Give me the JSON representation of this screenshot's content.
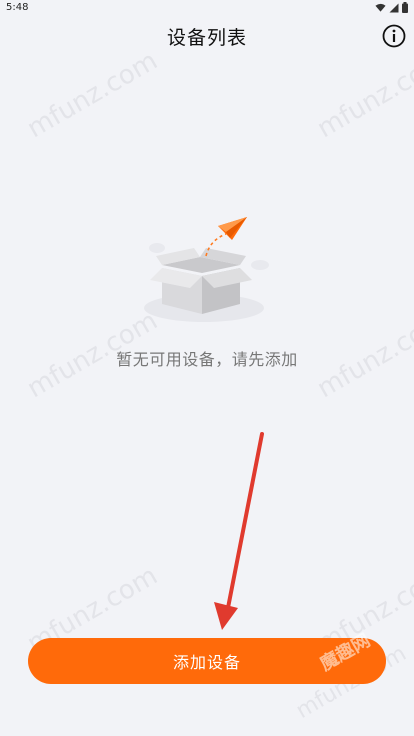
{
  "status_bar": {
    "time": "5:48"
  },
  "header": {
    "title": "设备列表",
    "info_icon": "info-circle-icon"
  },
  "empty_state": {
    "illustration": "empty-box-icon",
    "message": "暂无可用设备，请先添加"
  },
  "actions": {
    "add_device_label": "添加设备"
  },
  "watermark": {
    "text": "mfunz.com",
    "badge": "魔趣网"
  },
  "colors": {
    "background": "#f2f3f7",
    "accent": "#ff6a0a",
    "annotation_arrow": "#e03a2e"
  }
}
